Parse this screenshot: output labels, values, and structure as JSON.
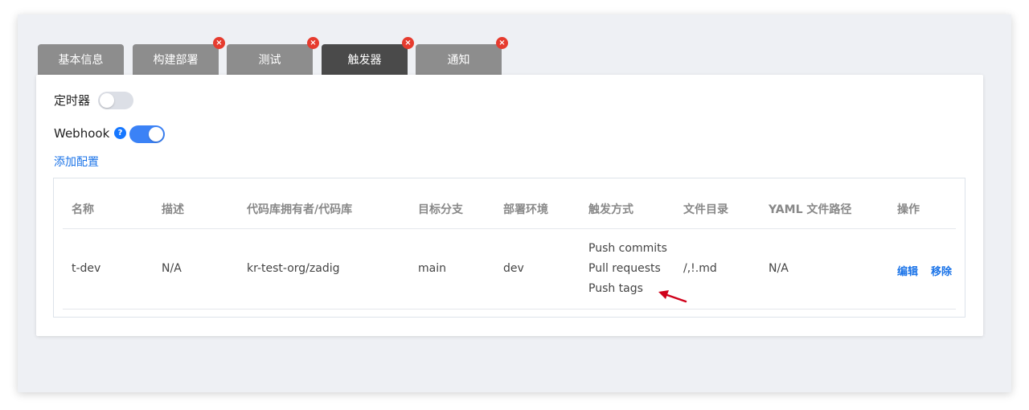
{
  "tabs": [
    {
      "label": "基本信息",
      "closable": false,
      "active": false
    },
    {
      "label": "构建部署",
      "closable": true,
      "active": false
    },
    {
      "label": "测试",
      "closable": true,
      "active": false
    },
    {
      "label": "触发器",
      "closable": true,
      "active": true
    },
    {
      "label": "通知",
      "closable": true,
      "active": false
    }
  ],
  "close_glyph": "×",
  "timer": {
    "label": "定时器",
    "enabled": false
  },
  "webhook": {
    "label": "Webhook",
    "help_glyph": "?",
    "enabled": true
  },
  "add_config_label": "添加配置",
  "table": {
    "headers": [
      "名称",
      "描述",
      "代码库拥有者/代码库",
      "目标分支",
      "部署环境",
      "触发方式",
      "文件目录",
      "YAML 文件路径",
      "操作"
    ],
    "rows": [
      {
        "name": "t-dev",
        "description": "N/A",
        "repo": "kr-test-org/zadig",
        "branch": "main",
        "env": "dev",
        "events": [
          "Push commits",
          "Pull requests",
          "Push tags"
        ],
        "file_path": "/,!.md",
        "yaml_path": "N/A",
        "edit_label": "编辑",
        "remove_label": "移除"
      }
    ]
  },
  "colors": {
    "accent": "#3b82f6",
    "link": "#1a73e8",
    "close": "#e63b2e",
    "arrow": "#d0021b",
    "tab": "#8d8d8d",
    "tab_active": "#4a4a4a"
  }
}
